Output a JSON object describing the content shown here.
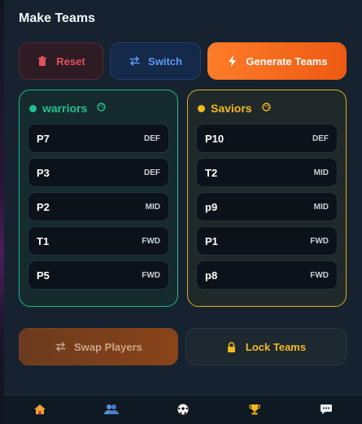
{
  "header": {
    "title": "Make Teams"
  },
  "actions": {
    "reset_label": "Reset",
    "switch_label": "Switch",
    "generate_label": "Generate Teams"
  },
  "teams": [
    {
      "name": "warriors",
      "color": "#22c08f",
      "players": [
        {
          "name": "P7",
          "position": "DEF"
        },
        {
          "name": "P3",
          "position": "DEF"
        },
        {
          "name": "P2",
          "position": "MID"
        },
        {
          "name": "T1",
          "position": "FWD"
        },
        {
          "name": "P5",
          "position": "FWD"
        }
      ]
    },
    {
      "name": "Saviors",
      "color": "#f2b91e",
      "players": [
        {
          "name": "P10",
          "position": "DEF"
        },
        {
          "name": "T2",
          "position": "MID"
        },
        {
          "name": "p9",
          "position": "MID"
        },
        {
          "name": "P1",
          "position": "FWD"
        },
        {
          "name": "p8",
          "position": "FWD"
        }
      ]
    }
  ],
  "footer_actions": {
    "swap_label": "Swap Players",
    "lock_label": "Lock Teams"
  },
  "bottom_nav": [
    {
      "icon": "home-icon"
    },
    {
      "icon": "players-icon"
    },
    {
      "icon": "soccer-ball-icon"
    },
    {
      "icon": "trophy-icon"
    },
    {
      "icon": "chat-icon"
    }
  ],
  "colors": {
    "accent_orange": "#ff7c2a",
    "danger": "#e0525a",
    "info": "#5b9af0",
    "team_a": "#22c08f",
    "team_b": "#f2b91e"
  }
}
